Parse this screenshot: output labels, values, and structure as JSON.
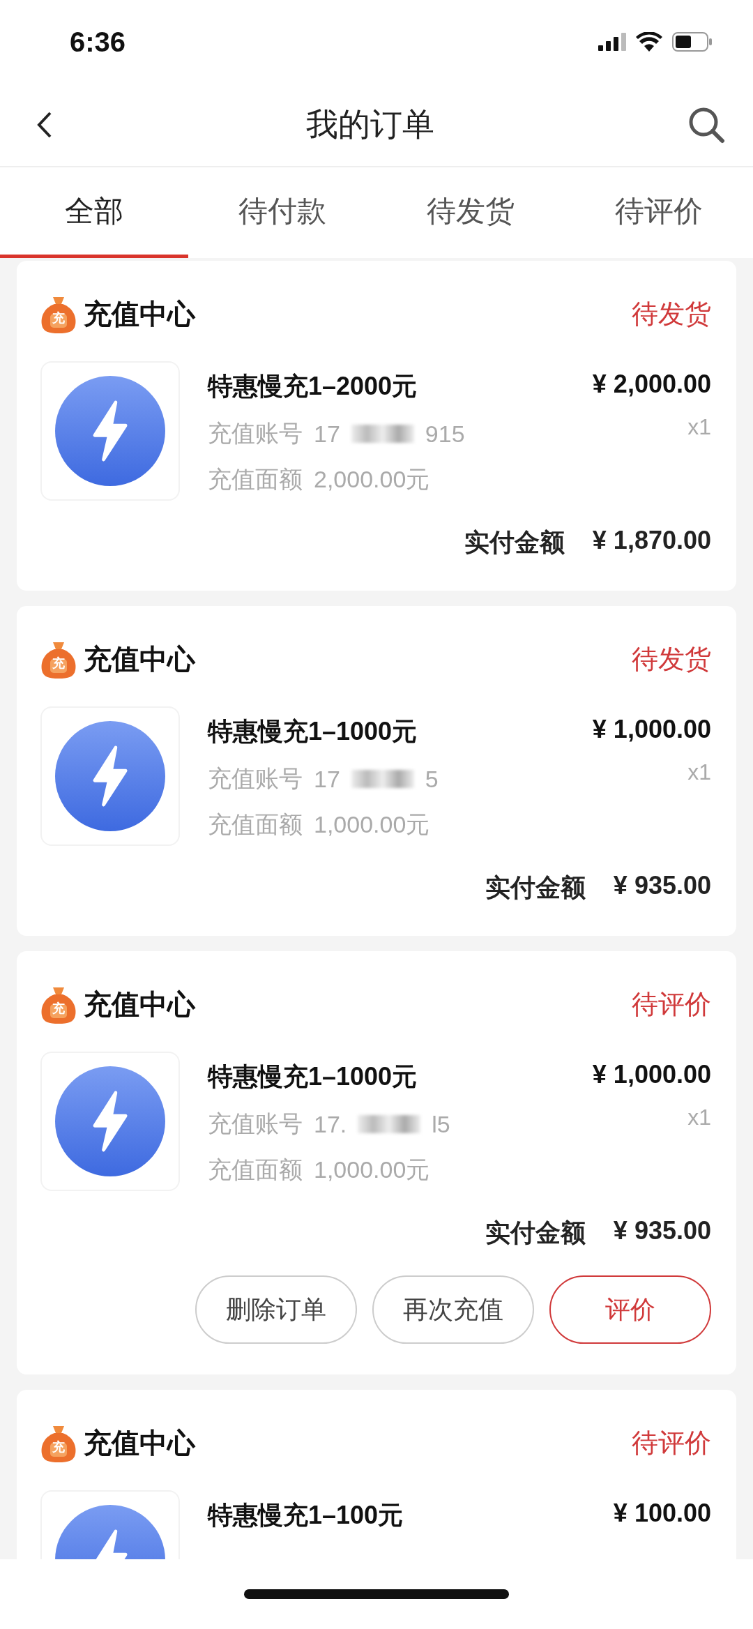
{
  "status_bar": {
    "time": "6:36"
  },
  "nav": {
    "title": "我的订单"
  },
  "tabs": [
    {
      "label": "全部",
      "selected": true
    },
    {
      "label": "待付款",
      "selected": false
    },
    {
      "label": "待发货",
      "selected": false
    },
    {
      "label": "待评价",
      "selected": false
    }
  ],
  "orders": [
    {
      "store": "充值中心",
      "badge": "充",
      "status": "待发货",
      "product": "特惠慢充1–2000元",
      "price": "¥ 2,000.00",
      "quantity": "x1",
      "account_label": "充值账号",
      "account_start": "17",
      "account_end": "915",
      "amount_label": "充值面额",
      "amount": "2,000.00元",
      "total_label": "实付金额",
      "total": "¥ 1,870.00"
    },
    {
      "store": "充值中心",
      "badge": "充",
      "status": "待发货",
      "product": "特惠慢充1–1000元",
      "price": "¥ 1,000.00",
      "quantity": "x1",
      "account_label": "充值账号",
      "account_start": "17",
      "account_end": "5",
      "amount_label": "充值面额",
      "amount": "1,000.00元",
      "total_label": "实付金额",
      "total": "¥ 935.00"
    },
    {
      "store": "充值中心",
      "badge": "充",
      "status": "待评价",
      "product": "特惠慢充1–1000元",
      "price": "¥ 1,000.00",
      "quantity": "x1",
      "account_label": "充值账号",
      "account_start": "17.",
      "account_end": "l5",
      "amount_label": "充值面额",
      "amount": "1,000.00元",
      "total_label": "实付金额",
      "total": "¥ 935.00",
      "actions": [
        {
          "label": "删除订单",
          "kind": "plain"
        },
        {
          "label": "再次充值",
          "kind": "plain"
        },
        {
          "label": "评价",
          "kind": "primary"
        }
      ]
    },
    {
      "store": "充值中心",
      "badge": "充",
      "status": "待评价",
      "product": "特惠慢充1–100元",
      "price": "¥ 100.00"
    }
  ]
}
